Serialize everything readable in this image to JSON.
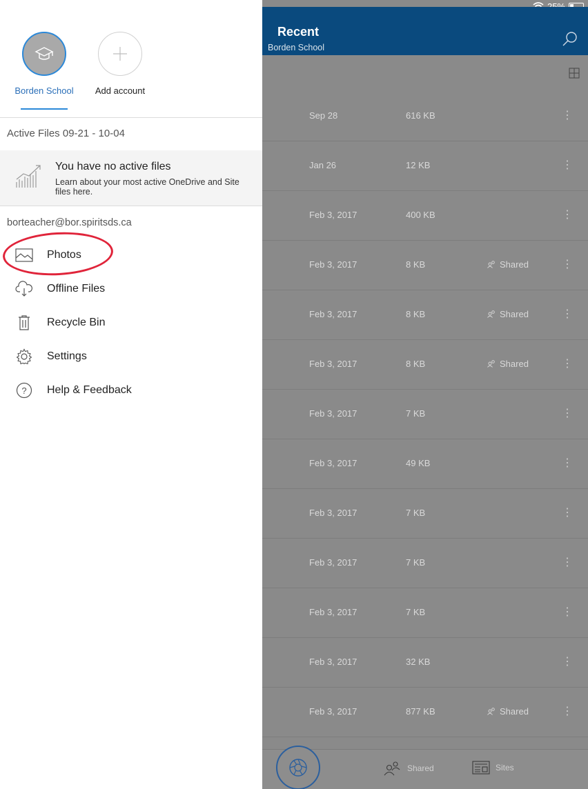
{
  "status_bar": {
    "battery": "25%",
    "icons": [
      "wifi-icon",
      "battery-icon"
    ]
  },
  "accounts": [
    {
      "label": "Borden School",
      "icon": "graduation-cap-icon",
      "selected": true
    },
    {
      "label": "Add account",
      "icon": "plus-icon",
      "selected": false
    }
  ],
  "active_files": {
    "title": "Active Files 09-21 - 10-04",
    "empty_title": "You have no active files",
    "empty_desc": "Learn about your most active OneDrive and Site files here."
  },
  "email": "borteacher@bor.spiritsds.ca",
  "nav": [
    {
      "label": "Photos",
      "icon": "photo-icon"
    },
    {
      "label": "Offline Files",
      "icon": "cloud-download-icon"
    },
    {
      "label": "Recycle Bin",
      "icon": "trash-icon"
    },
    {
      "label": "Settings",
      "icon": "gear-icon"
    },
    {
      "label": "Help & Feedback",
      "icon": "help-icon"
    }
  ],
  "header": {
    "title": "Recent",
    "subtitle": "Borden School"
  },
  "files": [
    {
      "date": "Sep 28",
      "size": "616 KB",
      "shared": ""
    },
    {
      "date": "Jan 26",
      "size": "12 KB",
      "shared": ""
    },
    {
      "date": "Feb 3, 2017",
      "size": "400 KB",
      "shared": ""
    },
    {
      "date": "Feb 3, 2017",
      "size": "8 KB",
      "shared": "Shared"
    },
    {
      "date": "Feb 3, 2017",
      "size": "8 KB",
      "shared": "Shared"
    },
    {
      "date": "Feb 3, 2017",
      "size": "8 KB",
      "shared": "Shared"
    },
    {
      "date": "Feb 3, 2017",
      "size": "7 KB",
      "shared": ""
    },
    {
      "date": "Feb 3, 2017",
      "size": "49 KB",
      "shared": ""
    },
    {
      "date": "Feb 3, 2017",
      "size": "7 KB",
      "shared": ""
    },
    {
      "date": "Feb 3, 2017",
      "size": "7 KB",
      "shared": ""
    },
    {
      "date": "Feb 3, 2017",
      "size": "7 KB",
      "shared": ""
    },
    {
      "date": "Feb 3, 2017",
      "size": "32 KB",
      "shared": ""
    },
    {
      "date": "Feb 3, 2017",
      "size": "877 KB",
      "shared": "Shared"
    }
  ],
  "bottom_tabs": {
    "shared": "Shared",
    "sites": "Sites"
  },
  "colors": {
    "header": "#0a4a7e",
    "accent": "#2b88d8",
    "annotation": "#e0243a"
  }
}
